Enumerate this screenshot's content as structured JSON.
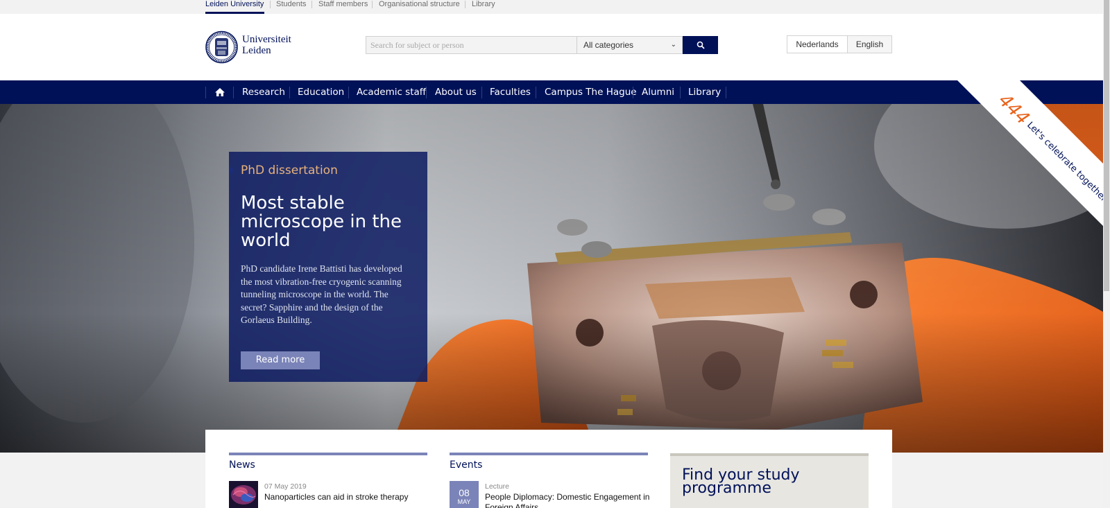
{
  "topbar": {
    "links": [
      "Leiden University",
      "Students",
      "Staff members",
      "Organisational structure",
      "Library"
    ]
  },
  "header": {
    "logo_line1": "Universiteit",
    "logo_line2": "Leiden",
    "search_placeholder": "Search for subject or person",
    "category_selected": "All categories",
    "lang_nl": "Nederlands",
    "lang_en": "English"
  },
  "nav": {
    "items": [
      "Research",
      "Education",
      "Academic staff",
      "About us",
      "Faculties",
      "Campus The Hague",
      "Alumni",
      "Library"
    ]
  },
  "hero": {
    "kicker": "PhD dissertation",
    "title": "Most stable microscope in the world",
    "text": "PhD candidate Irene Battisti has developed the most vibration-free cryogenic scanning tunneling microscope in the world. The secret? Sapphire and the design of the Gorlaeus Building.",
    "button": "Read more"
  },
  "ribbon": {
    "number": "444",
    "text": "Let's celebrate together"
  },
  "news": {
    "heading": "News",
    "date": "07 May 2019",
    "title": "Nanoparticles can aid in stroke therapy"
  },
  "events": {
    "heading": "Events",
    "day": "08",
    "month": "MAY",
    "type": "Lecture",
    "title": "People Diplomacy: Domestic Engagement in Foreign Affairs"
  },
  "study": {
    "title": "Find your study programme"
  },
  "colors": {
    "brand": "#001158",
    "accent": "#7b84b8",
    "orange": "#f26522"
  }
}
